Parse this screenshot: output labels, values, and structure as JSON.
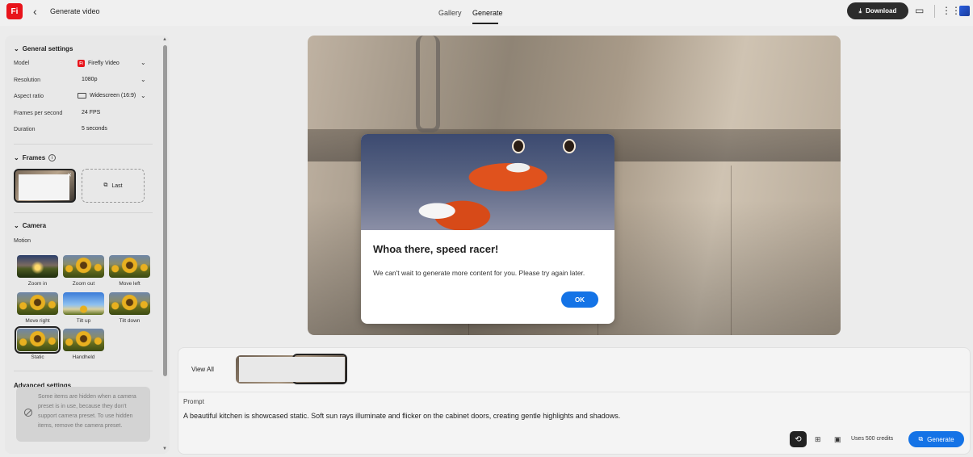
{
  "header": {
    "logo_text": "Fi",
    "page_title": "Generate video",
    "tabs": [
      {
        "label": "Gallery"
      },
      {
        "label": "Generate"
      }
    ],
    "download_label": "Download"
  },
  "left_panel": {
    "general_title": "General settings",
    "rows": [
      {
        "label": "Model",
        "value": "Firefly Video"
      },
      {
        "label": "Resolution",
        "value": "1080p"
      },
      {
        "label": "Aspect ratio",
        "value": "Widescreen (16:9)"
      },
      {
        "label": "Frames per second",
        "value": "24 FPS"
      },
      {
        "label": "Duration",
        "value": "5 seconds"
      }
    ],
    "frames_title": "Frames",
    "frames_last_label": "Last",
    "camera_title": "Camera",
    "motion_label": "Motion",
    "motions": [
      {
        "label": "Zoom in"
      },
      {
        "label": "Zoom out"
      },
      {
        "label": "Move left"
      },
      {
        "label": "Move right"
      },
      {
        "label": "Tilt up"
      },
      {
        "label": "Tilt down"
      },
      {
        "label": "Static"
      },
      {
        "label": "Handheld"
      }
    ],
    "advanced_title": "Advanced settings",
    "tooltip": "Some items are hidden when a camera preset is in use, because they don't support camera preset. To use hidden items, remove the camera preset."
  },
  "dialog": {
    "title": "Whoa there, speed racer!",
    "body": "We can't wait to generate more content for you. Please try again later.",
    "ok_label": "OK"
  },
  "bottom": {
    "view_all": "View All",
    "prompt_label": "Prompt",
    "prompt_text": "A beautiful kitchen is showcased static. Soft sun rays illuminate and flicker on the cabinet doors, creating gentle highlights and shadows.",
    "credits": "Uses 500 credits",
    "generate_label": "Generate"
  },
  "colors": {
    "brand_red": "#e8141b",
    "accent_blue": "#1473e6",
    "dark_button": "#2c2c2c"
  }
}
